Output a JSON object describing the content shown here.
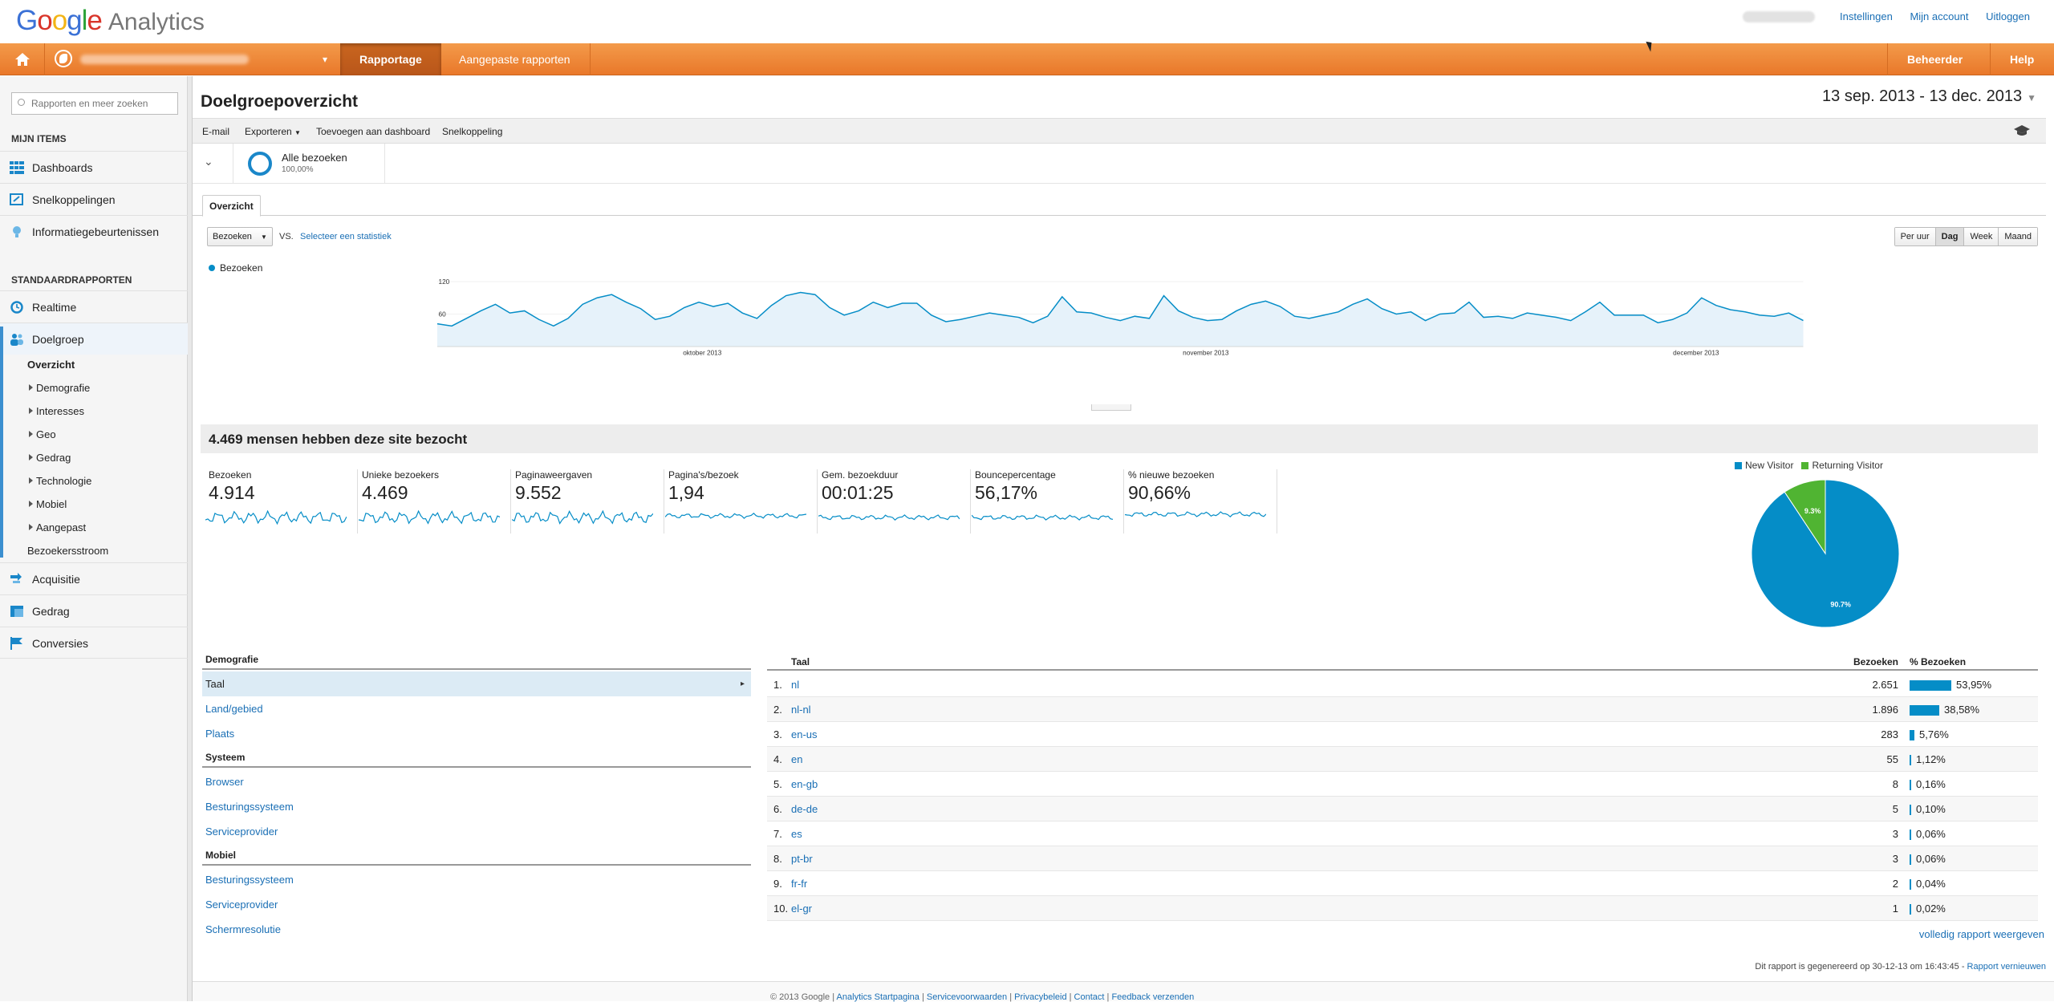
{
  "app": {
    "logo_google": "Google",
    "logo_analytics": "Analytics"
  },
  "toplinks": {
    "settings": "Instellingen",
    "account": "Mijn account",
    "logout": "Uitloggen"
  },
  "nav": {
    "reporting": "Rapportage",
    "custom": "Aangepaste rapporten",
    "admin": "Beheerder",
    "help": "Help"
  },
  "sidebar": {
    "search_placeholder": "Rapporten en meer zoeken",
    "my_items_header": "MIJN ITEMS",
    "my_items": [
      "Dashboards",
      "Snelkoppelingen",
      "Informatiegebeurtenissen"
    ],
    "standard_header": "STANDAARDRAPPORTEN",
    "realtime": "Realtime",
    "audience": "Doelgroep",
    "audience_sub": {
      "overview": "Overzicht",
      "items": [
        "Demografie",
        "Interesses",
        "Geo",
        "Gedrag",
        "Technologie",
        "Mobiel",
        "Aangepast"
      ],
      "flow": "Bezoekersstroom"
    },
    "acquisition": "Acquisitie",
    "behavior": "Gedrag",
    "conversions": "Conversies"
  },
  "page": {
    "title": "Doelgroepoverzicht",
    "date_range": "13 sep. 2013 - 13 dec. 2013",
    "toolbar": {
      "email": "E-mail",
      "export": "Exporteren",
      "add_dashboard": "Toevoegen aan dashboard",
      "shortcut": "Snelkoppeling"
    },
    "segment": {
      "name": "Alle bezoeken",
      "pct": "100,00%"
    },
    "tab": "Overzicht",
    "metric_select": "Bezoeken",
    "vs": "VS.",
    "select_stat": "Selecteer een statistiek",
    "granularity": [
      "Per uur",
      "Dag",
      "Week",
      "Maand"
    ],
    "granularity_active": "Dag",
    "summary_title": "4.469 mensen hebben deze site bezocht"
  },
  "chart_data": [
    {
      "type": "line",
      "series": [
        {
          "name": "Bezoeken",
          "values": [
            42,
            38,
            52,
            66,
            78,
            62,
            66,
            50,
            38,
            52,
            78,
            90,
            96,
            82,
            70,
            50,
            56,
            72,
            82,
            74,
            80,
            62,
            52,
            76,
            94,
            100,
            96,
            72,
            58,
            66,
            82,
            72,
            80,
            80,
            58,
            46,
            50,
            56,
            62,
            58,
            54,
            44,
            56,
            92,
            64,
            62,
            54,
            48,
            56,
            52,
            94,
            66,
            54,
            48,
            50,
            66,
            78,
            84,
            74,
            56,
            52,
            58,
            64,
            78,
            88,
            70,
            60,
            64,
            48,
            60,
            62,
            82,
            54,
            56,
            52,
            62,
            58,
            54,
            48,
            64,
            82,
            58,
            58,
            58,
            44,
            50,
            62,
            90,
            76,
            68,
            64,
            58,
            56,
            62,
            48
          ]
        }
      ],
      "yticks": [
        60,
        120
      ],
      "xlabels": [
        "oktober 2013",
        "november 2013",
        "december 2013"
      ],
      "ylim": [
        0,
        120
      ],
      "legend": "top-left"
    },
    {
      "type": "pie",
      "slices": [
        {
          "name": "New Visitor",
          "value": 90.7,
          "label": "90.7%",
          "color": "#058dc7"
        },
        {
          "name": "Returning Visitor",
          "value": 9.3,
          "label": "9.3%",
          "color": "#50b432"
        }
      ],
      "legend": "top"
    }
  ],
  "metrics": [
    {
      "label": "Bezoeken",
      "value": "4.914"
    },
    {
      "label": "Unieke bezoekers",
      "value": "4.469"
    },
    {
      "label": "Paginaweergaven",
      "value": "9.552"
    },
    {
      "label": "Pagina's/bezoek",
      "value": "1,94"
    },
    {
      "label": "Gem. bezoekduur",
      "value": "00:01:25"
    },
    {
      "label": "Bouncepercentage",
      "value": "56,17%"
    },
    {
      "label": "% nieuwe bezoeken",
      "value": "90,66%"
    }
  ],
  "demographics": {
    "header_demo": "Demografie",
    "demo_links": [
      "Taal",
      "Land/gebied",
      "Plaats"
    ],
    "header_system": "Systeem",
    "system_links": [
      "Browser",
      "Besturingssysteem",
      "Serviceprovider"
    ],
    "header_mobile": "Mobiel",
    "mobile_links": [
      "Besturingssysteem",
      "Serviceprovider",
      "Schermresolutie"
    ]
  },
  "language_table": {
    "col_lang": "Taal",
    "col_visits": "Bezoeken",
    "col_pct": "% Bezoeken",
    "rows": [
      {
        "n": "1.",
        "lang": "nl",
        "visits": "2.651",
        "pct": "53,95%",
        "frac": 0.5395
      },
      {
        "n": "2.",
        "lang": "nl-nl",
        "visits": "1.896",
        "pct": "38,58%",
        "frac": 0.3858
      },
      {
        "n": "3.",
        "lang": "en-us",
        "visits": "283",
        "pct": "5,76%",
        "frac": 0.0576
      },
      {
        "n": "4.",
        "lang": "en",
        "visits": "55",
        "pct": "1,12%",
        "frac": 0.0112
      },
      {
        "n": "5.",
        "lang": "en-gb",
        "visits": "8",
        "pct": "0,16%",
        "frac": 0.0016
      },
      {
        "n": "6.",
        "lang": "de-de",
        "visits": "5",
        "pct": "0,10%",
        "frac": 0.001
      },
      {
        "n": "7.",
        "lang": "es",
        "visits": "3",
        "pct": "0,06%",
        "frac": 0.0006
      },
      {
        "n": "8.",
        "lang": "pt-br",
        "visits": "3",
        "pct": "0,06%",
        "frac": 0.0006
      },
      {
        "n": "9.",
        "lang": "fr-fr",
        "visits": "2",
        "pct": "0,04%",
        "frac": 0.0004
      },
      {
        "n": "10.",
        "lang": "el-gr",
        "visits": "1",
        "pct": "0,02%",
        "frac": 0.0002
      }
    ],
    "full_report": "volledig rapport weergeven"
  },
  "footer": {
    "generated": "Dit rapport is gegenereerd op 30-12-13 om 16:43:45 -",
    "refresh": "Rapport vernieuwen",
    "copyright": "© 2013 Google",
    "links": [
      "Analytics Startpagina",
      "Servicevoorwaarden",
      "Privacybeleid",
      "Contact",
      "Feedback verzenden"
    ]
  },
  "colors": {
    "accent": "#058dc7",
    "orange": "#e9782a",
    "returning": "#50b432"
  }
}
